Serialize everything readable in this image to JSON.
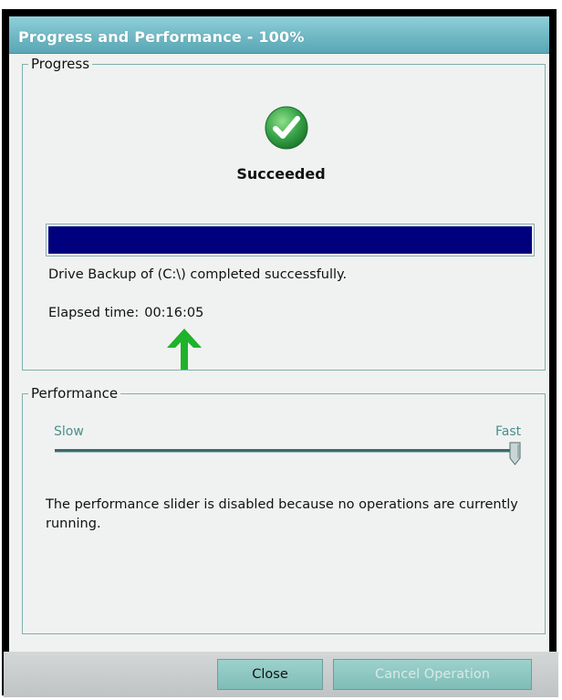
{
  "window": {
    "title": "Progress and Performance - 100%"
  },
  "progress": {
    "legend": "Progress",
    "status_icon": "checkmark-success-icon",
    "status_text": "Succeeded",
    "percent": 100,
    "message": "Drive Backup of  (C:\\) completed successfully.",
    "elapsed_label": "Elapsed time:",
    "elapsed_value": "00:16:05",
    "annotation_icon": "green-up-arrow-icon"
  },
  "performance": {
    "legend": "Performance",
    "slider_min_label": "Slow",
    "slider_max_label": "Fast",
    "slider_level": 1.0,
    "slider_enabled": false,
    "note": "The performance slider is disabled because no operations are currently running."
  },
  "buttons": {
    "close": "Close",
    "cancel": "Cancel Operation"
  },
  "colors": {
    "titlebar": "#6fb8c4",
    "progress_fill": "#00007f",
    "success_green": "#3aa64a",
    "annotation_arrow": "#1fb22a",
    "button": "#8fc8c2"
  }
}
